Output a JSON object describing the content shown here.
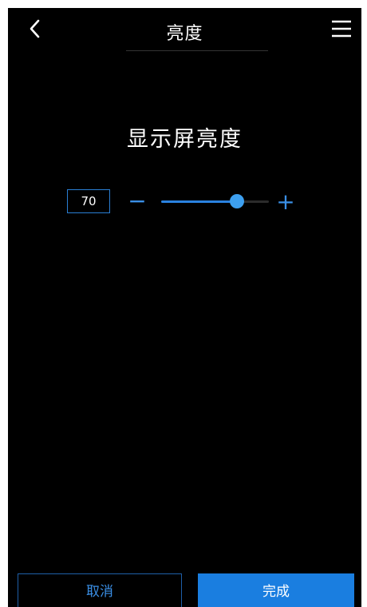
{
  "header": {
    "title": "亮度",
    "back_icon": "chevron-left-icon",
    "menu_icon": "hamburger-menu-icon"
  },
  "main": {
    "section_title": "显示屏亮度",
    "brightness": {
      "value": "70",
      "level_percent": 70,
      "minus_label": "−",
      "plus_label": "+"
    }
  },
  "footer": {
    "cancel_label": "取消",
    "done_label": "完成"
  },
  "colors": {
    "accent": "#2a82e0",
    "background": "#000000",
    "text": "#ffffff"
  }
}
